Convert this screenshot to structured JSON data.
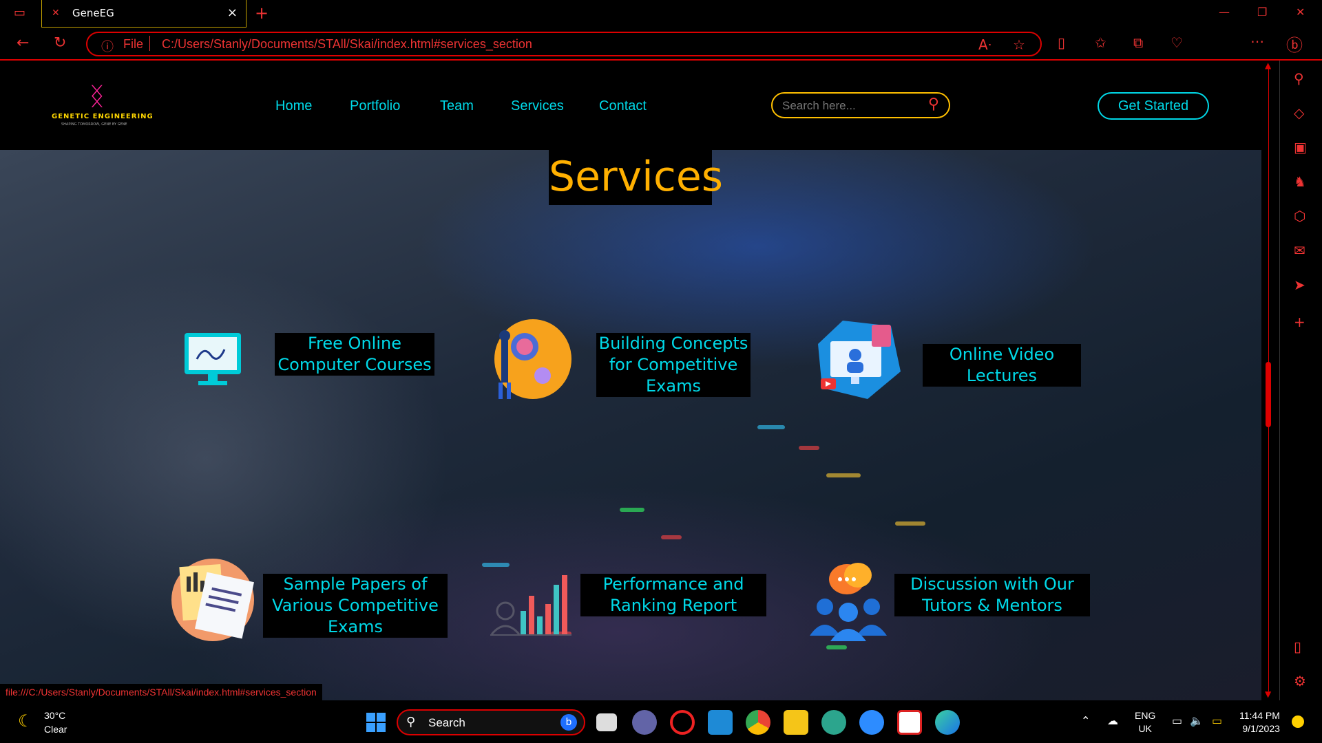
{
  "browser": {
    "tab_title": "GeneEG",
    "url_scheme": "File",
    "url": "C:/Users/Stanly/Documents/STAll/Skai/index.html#services_section",
    "status_url": "file:///C:/Users/Stanly/Documents/STAll/Skai/index.html#services_section"
  },
  "site": {
    "logo_name": "GENETIC ENGINEERING",
    "logo_tagline": "SHAPING TOMORROW, GENE BY GENE",
    "nav": [
      "Home",
      "Portfolio",
      "Team",
      "Services",
      "Contact"
    ],
    "search_placeholder": "Search here...",
    "cta": "Get Started",
    "section_title": "Services",
    "services": [
      {
        "label": "Free Online Computer Courses",
        "icon": "computer-monitor-icon"
      },
      {
        "label": "Building Concepts for Competitive Exams",
        "icon": "brain-concept-icon"
      },
      {
        "label": "Online Video Lectures",
        "icon": "video-lecture-icon"
      },
      {
        "label": "Sample Papers of Various Competitive Exams",
        "icon": "sample-papers-icon"
      },
      {
        "label": "Performance and Ranking Report",
        "icon": "bar-chart-icon"
      },
      {
        "label": "Discussion with Our Tutors & Mentors",
        "icon": "discussion-group-icon"
      }
    ]
  },
  "taskbar": {
    "temperature": "30°C",
    "condition": "Clear",
    "search_label": "Search",
    "lang_top": "ENG",
    "lang_bottom": "UK",
    "time": "11:44 PM",
    "date": "9/1/2023"
  },
  "colors": {
    "accent_red": "#dd0000",
    "cyan": "#00d9e8",
    "gold": "#ffb000"
  }
}
